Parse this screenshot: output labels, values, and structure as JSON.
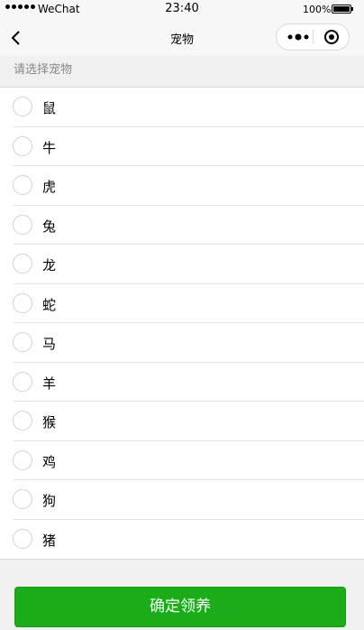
{
  "status_bar": {
    "carrier": "WeChat",
    "time": "23:40",
    "battery_percent": "100%",
    "battery_level": 1.0
  },
  "nav": {
    "title": "宠物",
    "back_icon": "chevron-left-icon",
    "more_icon": "more-dots-icon",
    "close_icon": "target-circle-icon"
  },
  "form": {
    "section_title": "请选择宠物",
    "options": [
      "鼠",
      "牛",
      "虎",
      "兔",
      "龙",
      "蛇",
      "马",
      "羊",
      "猴",
      "鸡",
      "狗",
      "猪"
    ]
  },
  "actions": {
    "confirm_label": "确定领养"
  },
  "colors": {
    "primary": "#1aad19",
    "background": "#f0f0f0"
  }
}
